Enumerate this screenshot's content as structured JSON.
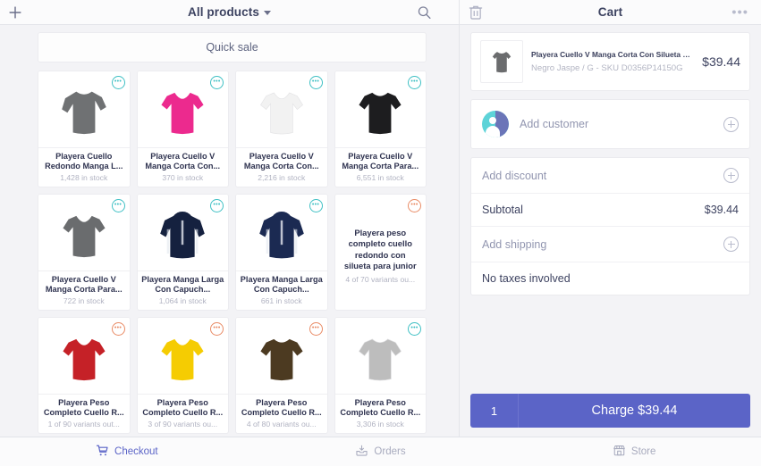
{
  "topbar": {
    "add_icon": "plus-icon",
    "title": "All products",
    "dropdown_icon": "chevron-down-icon",
    "search_icon": "search-icon",
    "cart_title": "Cart",
    "trash_icon": "trash-icon",
    "more_icon": "more-options-icon"
  },
  "products": {
    "quick_sale_label": "Quick sale",
    "items": [
      {
        "title": "Playera Cuello Redondo Manga L...",
        "stock": "1,428 in stock",
        "badge": "teal",
        "color": "#6f7173",
        "style": "longsleeve",
        "has_image": true
      },
      {
        "title": "Playera Cuello V Manga Corta Con...",
        "stock": "370 in stock",
        "badge": "teal",
        "color": "#ec2a8e",
        "style": "vneck",
        "has_image": true
      },
      {
        "title": "Playera Cuello V Manga Corta Con...",
        "stock": "2,216 in stock",
        "badge": "teal",
        "color": "#f2f2f2",
        "style": "vneck",
        "has_image": true
      },
      {
        "title": "Playera Cuello V Manga Corta Para...",
        "stock": "6,551 in stock",
        "badge": "teal",
        "color": "#1d1d1f",
        "style": "tee",
        "has_image": true
      },
      {
        "title": "Playera Cuello V Manga Corta Para...",
        "stock": "722 in stock",
        "badge": "teal",
        "color": "#6a6c6e",
        "style": "vneck",
        "has_image": true
      },
      {
        "title": "Playera Manga Larga Con Capuch...",
        "stock": "1,064 in stock",
        "badge": "teal",
        "color": "#15213f",
        "style": "hoodie",
        "has_image": true
      },
      {
        "title": "Playera Manga Larga Con Capuch...",
        "stock": "661 in stock",
        "badge": "teal",
        "color": "#1b2a52",
        "style": "hoodie",
        "has_image": true
      },
      {
        "title": "Playera peso completo cuello redondo con silueta para junior",
        "stock": "4 of 70 variants ou...",
        "badge": "orange",
        "color": "",
        "style": "none",
        "has_image": false
      },
      {
        "title": "Playera Peso Completo Cuello R...",
        "stock": "1 of 90 variants out...",
        "badge": "orange",
        "color": "#c52127",
        "style": "vneck",
        "has_image": true
      },
      {
        "title": "Playera Peso Completo Cuello R...",
        "stock": "3 of 90 variants ou...",
        "badge": "orange",
        "color": "#f5cc02",
        "style": "vneck",
        "has_image": true
      },
      {
        "title": "Playera Peso Completo Cuello R...",
        "stock": "4 of 80 variants ou...",
        "badge": "orange",
        "color": "#4c3a21",
        "style": "tee",
        "has_image": true
      },
      {
        "title": "Playera Peso Completo Cuello R...",
        "stock": "3,306 in stock",
        "badge": "teal",
        "color": "#bdbdbd",
        "style": "tee",
        "has_image": true
      }
    ]
  },
  "cart": {
    "line_item": {
      "title": "Playera Cuello V Manga Corta Con Silueta Para Dama",
      "variant": "Negro Jaspe / G - SKU D0356P14150G",
      "price": "$39.44",
      "thumb_color": "#6b6c6e"
    },
    "add_customer_label": "Add customer",
    "add_customer_icon": "plus-circle-icon",
    "avatar_icon": "customer-avatar-icon",
    "add_discount_label": "Add discount",
    "add_discount_icon": "plus-circle-icon",
    "subtotal_label": "Subtotal",
    "subtotal_value": "$39.44",
    "add_shipping_label": "Add shipping",
    "add_shipping_icon": "plus-circle-icon",
    "taxes_label": "No taxes involved",
    "charge_qty": "1",
    "charge_label": "Charge $39.44"
  },
  "tabbar": {
    "tabs": [
      {
        "label": "Checkout",
        "icon": "shopping-cart-icon",
        "active": true
      },
      {
        "label": "Orders",
        "icon": "orders-inbox-icon",
        "active": false
      },
      {
        "label": "Store",
        "icon": "store-icon",
        "active": false
      }
    ]
  },
  "colors": {
    "accent": "#5b64c7",
    "badge_teal": "#3fc0c4",
    "badge_orange": "#e98b65",
    "page_bg": "#f3f3f6"
  }
}
